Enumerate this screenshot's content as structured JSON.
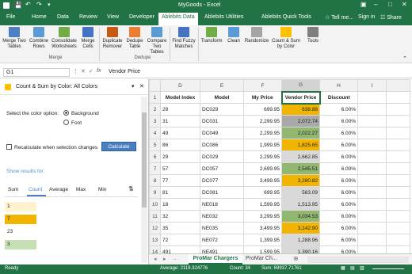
{
  "title": "MyGoods - Excel",
  "tabs": [
    "File",
    "Home",
    "Data",
    "Review",
    "View",
    "Developer",
    "Ablebits Data",
    "Ablebits Utilities",
    "Ablebits Quick Tools"
  ],
  "tell_me": "Tell me...",
  "signin": "Sign in",
  "share": "Share",
  "ribbon": {
    "buttons": [
      "Merge Two Tables",
      "Combine Rows",
      "Consolidate Worksheets",
      "Merge Cells",
      "Duplicate Remover",
      "Dedupe Table",
      "Compare Two Tables",
      "Find Fuzzy Matches",
      "Transform",
      "Clean",
      "Randomize",
      "Count & Sum by Color",
      "Tools"
    ],
    "groups": [
      "Merge",
      "Dedupe"
    ]
  },
  "namebox": "G1",
  "formula": "Vendor Price",
  "pane": {
    "title": "Count & Sum by Color: All Colors",
    "color_option_label": "Select the color option:",
    "opt_background": "Background",
    "opt_font": "Font",
    "recalc_label": "Recalculate when selection changes",
    "calculate": "Calculate",
    "show_results": "Show results for:",
    "result_tabs": [
      "Sum",
      "Count",
      "Average",
      "Max",
      "Min"
    ],
    "sort_icon": "sort-icon",
    "results": [
      {
        "color": "#fff2cc",
        "value": "1"
      },
      {
        "color": "#f1b400",
        "value": "7"
      },
      {
        "color": "#ffffff",
        "value": "23"
      },
      {
        "color": "#c6e0b4",
        "value": "3"
      }
    ]
  },
  "grid": {
    "col_letters": [
      "D",
      "E",
      "F",
      "G",
      "H",
      "I"
    ],
    "headers": [
      "Model Index",
      "Model",
      "My Price",
      "Vendor Price",
      "Discount",
      ""
    ],
    "rows": [
      {
        "n": "2",
        "d": "29",
        "e": "DC029",
        "f": "699.95",
        "g": "638.88",
        "gc": "#f1b400",
        "h": "6.00%"
      },
      {
        "n": "3",
        "d": "31",
        "e": "DC031",
        "f": "2,299.95",
        "g": "2,072.74",
        "gc": "#a9a9a9",
        "h": "6.00%"
      },
      {
        "n": "4",
        "d": "49",
        "e": "DC049",
        "f": "2,299.95",
        "g": "2,022.27",
        "gc": "#92b771",
        "h": "6.00%"
      },
      {
        "n": "5",
        "d": "86",
        "e": "DC086",
        "f": "1,999.95",
        "g": "1,825.65",
        "gc": "#f1b400",
        "h": "6.00%"
      },
      {
        "n": "6",
        "d": "29",
        "e": "DC029",
        "f": "2,299.95",
        "g": "2,662.85",
        "gc": "#d9d9d9",
        "h": "6.00%"
      },
      {
        "n": "7",
        "d": "57",
        "e": "DC057",
        "f": "2,699.95",
        "g": "2,545.51",
        "gc": "#92b771",
        "h": "6.00%"
      },
      {
        "n": "8",
        "d": "77",
        "e": "DC077",
        "f": "3,499.95",
        "g": "3,280.82",
        "gc": "#f1b400",
        "h": "6.00%"
      },
      {
        "n": "9",
        "d": "81",
        "e": "DC081",
        "f": "699.95",
        "g": "583.09",
        "gc": "#d9d9d9",
        "h": "6.00%"
      },
      {
        "n": "10",
        "d": "18",
        "e": "NE018",
        "f": "1,599.95",
        "g": "1,513.95",
        "gc": "#d9d9d9",
        "h": "6.00%"
      },
      {
        "n": "11",
        "d": "32",
        "e": "NE032",
        "f": "3,299.95",
        "g": "3,034.53",
        "gc": "#92b771",
        "h": "6.00%"
      },
      {
        "n": "12",
        "d": "35",
        "e": "NE035",
        "f": "3,499.95",
        "g": "3,142.90",
        "gc": "#f1b400",
        "h": "6.00%"
      },
      {
        "n": "13",
        "d": "72",
        "e": "NE072",
        "f": "1,399.95",
        "g": "1,288.96",
        "gc": "#d9d9d9",
        "h": "6.00%"
      },
      {
        "n": "14",
        "d": "491",
        "e": "NE491",
        "f": "1,599.95",
        "g": "1,390.16",
        "gc": "#d9d9d9",
        "h": "6.00%"
      },
      {
        "n": "15",
        "d": "2",
        "e": "SA002",
        "f": "2,799.95",
        "g": "2,581.08",
        "gc": "#d9d9d9",
        "h": "6.00%"
      }
    ]
  },
  "sheets": [
    "ProMar Chargers",
    "ProMar Ch..."
  ],
  "status": {
    "ready": "Ready",
    "average": "Average: 2119.324776",
    "count": "Count: 34",
    "sum": "Sum: 69937.71761"
  }
}
